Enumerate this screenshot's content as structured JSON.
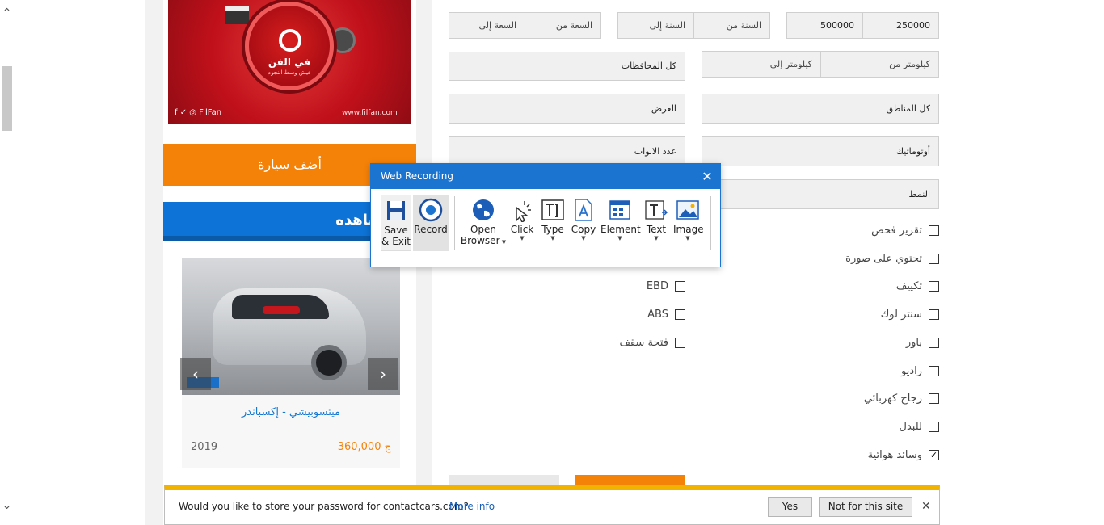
{
  "ad": {
    "brand_ar": "في الفن",
    "tagline_ar": "عيش وسط النجوم",
    "social": "f ✓ ◎ FilFan",
    "url": "www.filfan.com"
  },
  "sidebar": {
    "add_car_label": "أضف سيارة",
    "views_header": "مشاهده",
    "car": {
      "title": "ميتسوبيشي - إكسباندر",
      "price": "360,000 ج",
      "year": "2019"
    }
  },
  "filters": {
    "price_from": "250000",
    "price_to": "500000",
    "year_from": "السنة من",
    "year_to": "السنة إلى",
    "capacity_from": "السعة من",
    "capacity_to": "السعة إلى",
    "km_from": "كيلومتر من",
    "km_to": "كيلومتر إلى",
    "governorates": "كل المحافظات",
    "regions": "كل المناطق",
    "purpose": "الغرض",
    "transmission": "أوتوماتيك",
    "doors": "عدد الابواب",
    "style": "النمط"
  },
  "checkboxes_right": [
    {
      "label": "تقرير فحص",
      "checked": false
    },
    {
      "label": "تحتوي على صورة",
      "checked": false
    },
    {
      "label": "تكييف",
      "checked": false
    },
    {
      "label": "سنتر لوك",
      "checked": false
    },
    {
      "label": "باور",
      "checked": false
    },
    {
      "label": "راديو",
      "checked": false
    },
    {
      "label": "زجاج كهربائي",
      "checked": false
    },
    {
      "label": "للبدل",
      "checked": false
    },
    {
      "label": "وسائد هوائية",
      "checked": true
    }
  ],
  "checkboxes_left": [
    {
      "label": "EBD",
      "checked": false
    },
    {
      "label": "ABS",
      "checked": false
    },
    {
      "label": "فتحة سقف",
      "checked": false
    }
  ],
  "recorder": {
    "title": "Web Recording",
    "tools": {
      "save_line1": "Save",
      "save_line2": "& Exit",
      "record": "Record",
      "open_line1": "Open",
      "open_line2": "Browser",
      "click": "Click",
      "type": "Type",
      "copy": "Copy",
      "element": "Element",
      "text": "Text",
      "image": "Image"
    }
  },
  "password_bar": {
    "question": "Would you like to store your password for contactcars.com?",
    "more_info": "More info",
    "yes": "Yes",
    "not_for_site": "Not for this site"
  },
  "colors": {
    "orange": "#f58208",
    "blue": "#0d73d6",
    "recorder_blue": "#1a74d0",
    "infobar_yellow": "#f2b200"
  }
}
